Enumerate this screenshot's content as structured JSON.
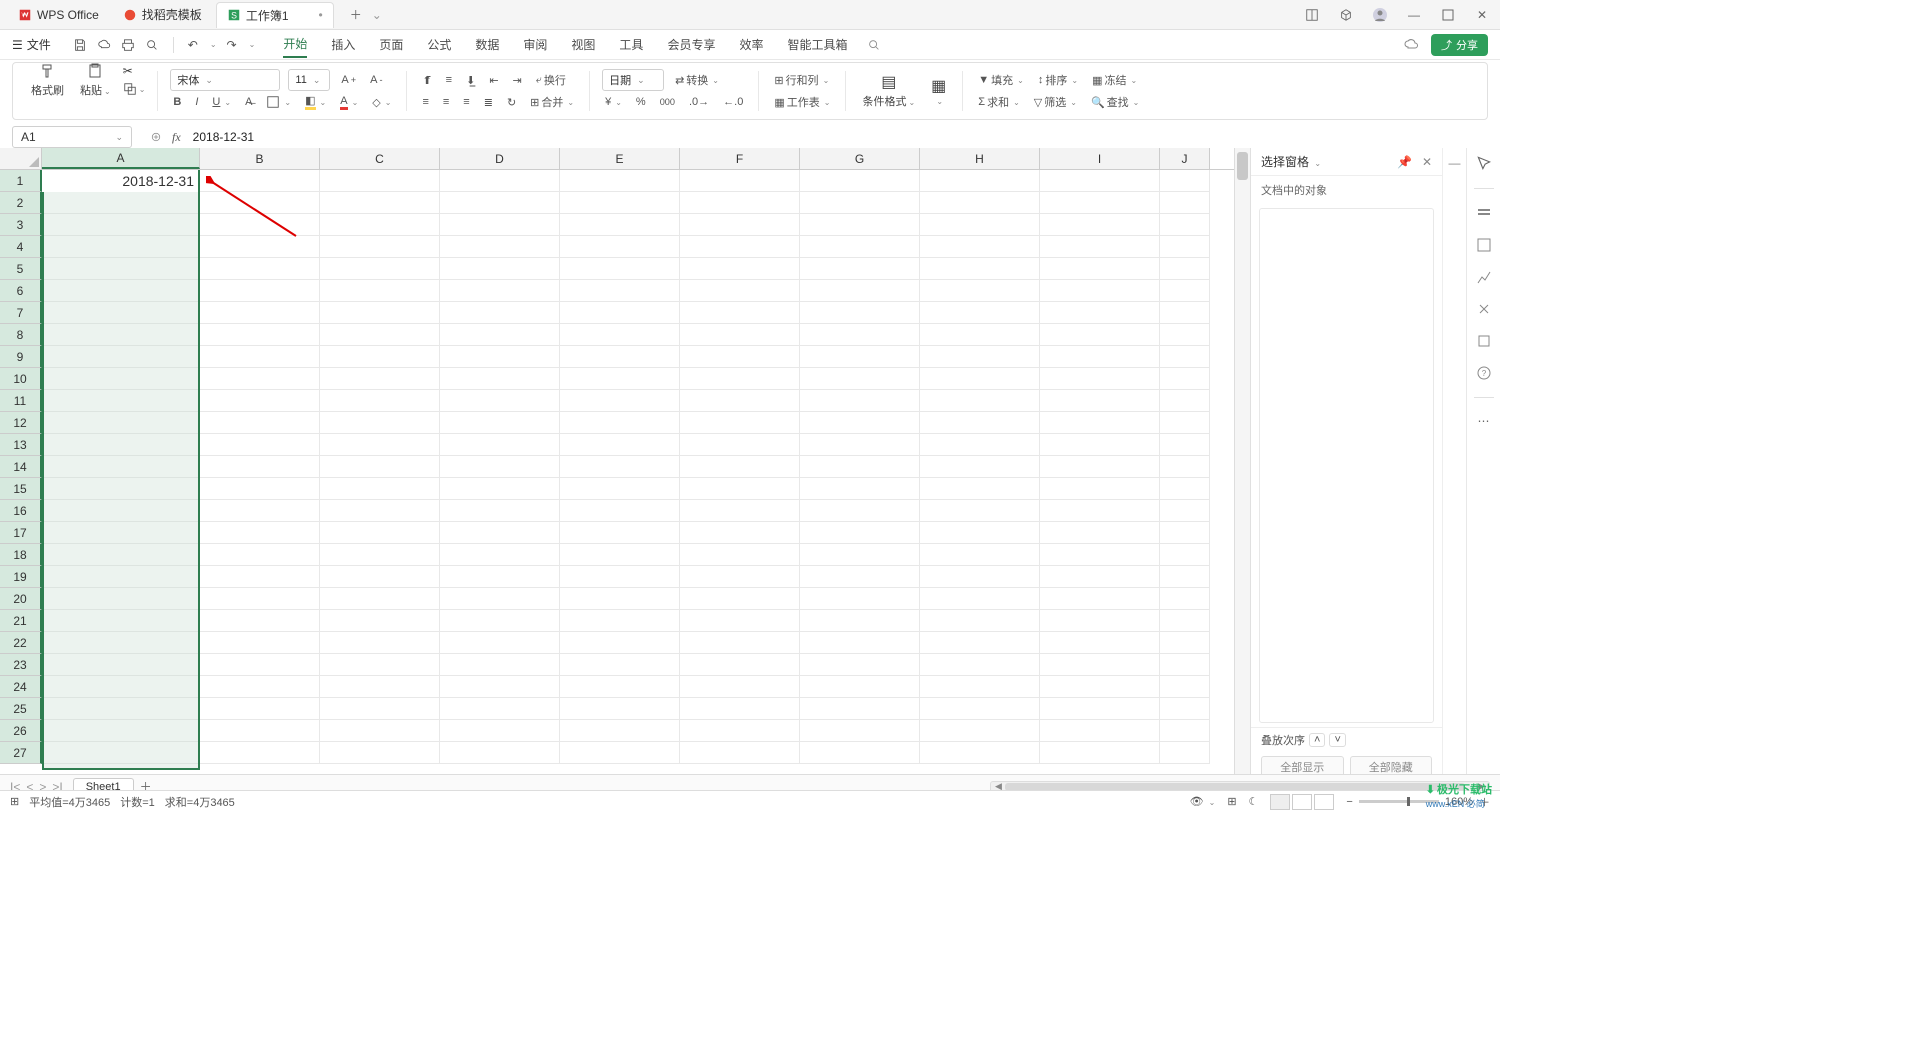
{
  "app": {
    "name": "WPS Office"
  },
  "tabs": {
    "template": "找稻壳模板",
    "workbook": "工作簿1"
  },
  "menubar": {
    "file": "文件",
    "items": [
      "开始",
      "插入",
      "页面",
      "公式",
      "数据",
      "审阅",
      "视图",
      "工具",
      "会员专享",
      "效率",
      "智能工具箱"
    ],
    "active": "开始",
    "share": "分享"
  },
  "ribbon": {
    "format_painter": "格式刷",
    "paste": "粘贴",
    "font_name": "宋体",
    "font_size": "11",
    "wrap": "换行",
    "merge": "合并",
    "number_format": "日期",
    "convert": "转换",
    "rowcol": "行和列",
    "worksheet": "工作表",
    "cond_format": "条件格式",
    "fill": "填充",
    "sort": "排序",
    "freeze": "冻结",
    "sum": "求和",
    "filter": "筛选",
    "find": "查找"
  },
  "cell": {
    "ref": "A1",
    "formula": "2018-12-31",
    "value": "2018-12-31"
  },
  "columns": [
    "A",
    "B",
    "C",
    "D",
    "E",
    "F",
    "G",
    "H",
    "I",
    "J"
  ],
  "row_count": 27,
  "sheet": {
    "name": "Sheet1"
  },
  "right_panel": {
    "title": "选择窗格",
    "subtitle": "文档中的对象",
    "stack_order": "叠放次序",
    "show_all": "全部显示",
    "hide_all": "全部隐藏"
  },
  "status": {
    "avg": "平均值=4万3465",
    "count": "计数=1",
    "sum": "求和=4万3465",
    "zoom": "160%",
    "ime": "EN 必简"
  },
  "watermark": {
    "top": "极光下载站",
    "bottom": "www.xEN 必简"
  }
}
